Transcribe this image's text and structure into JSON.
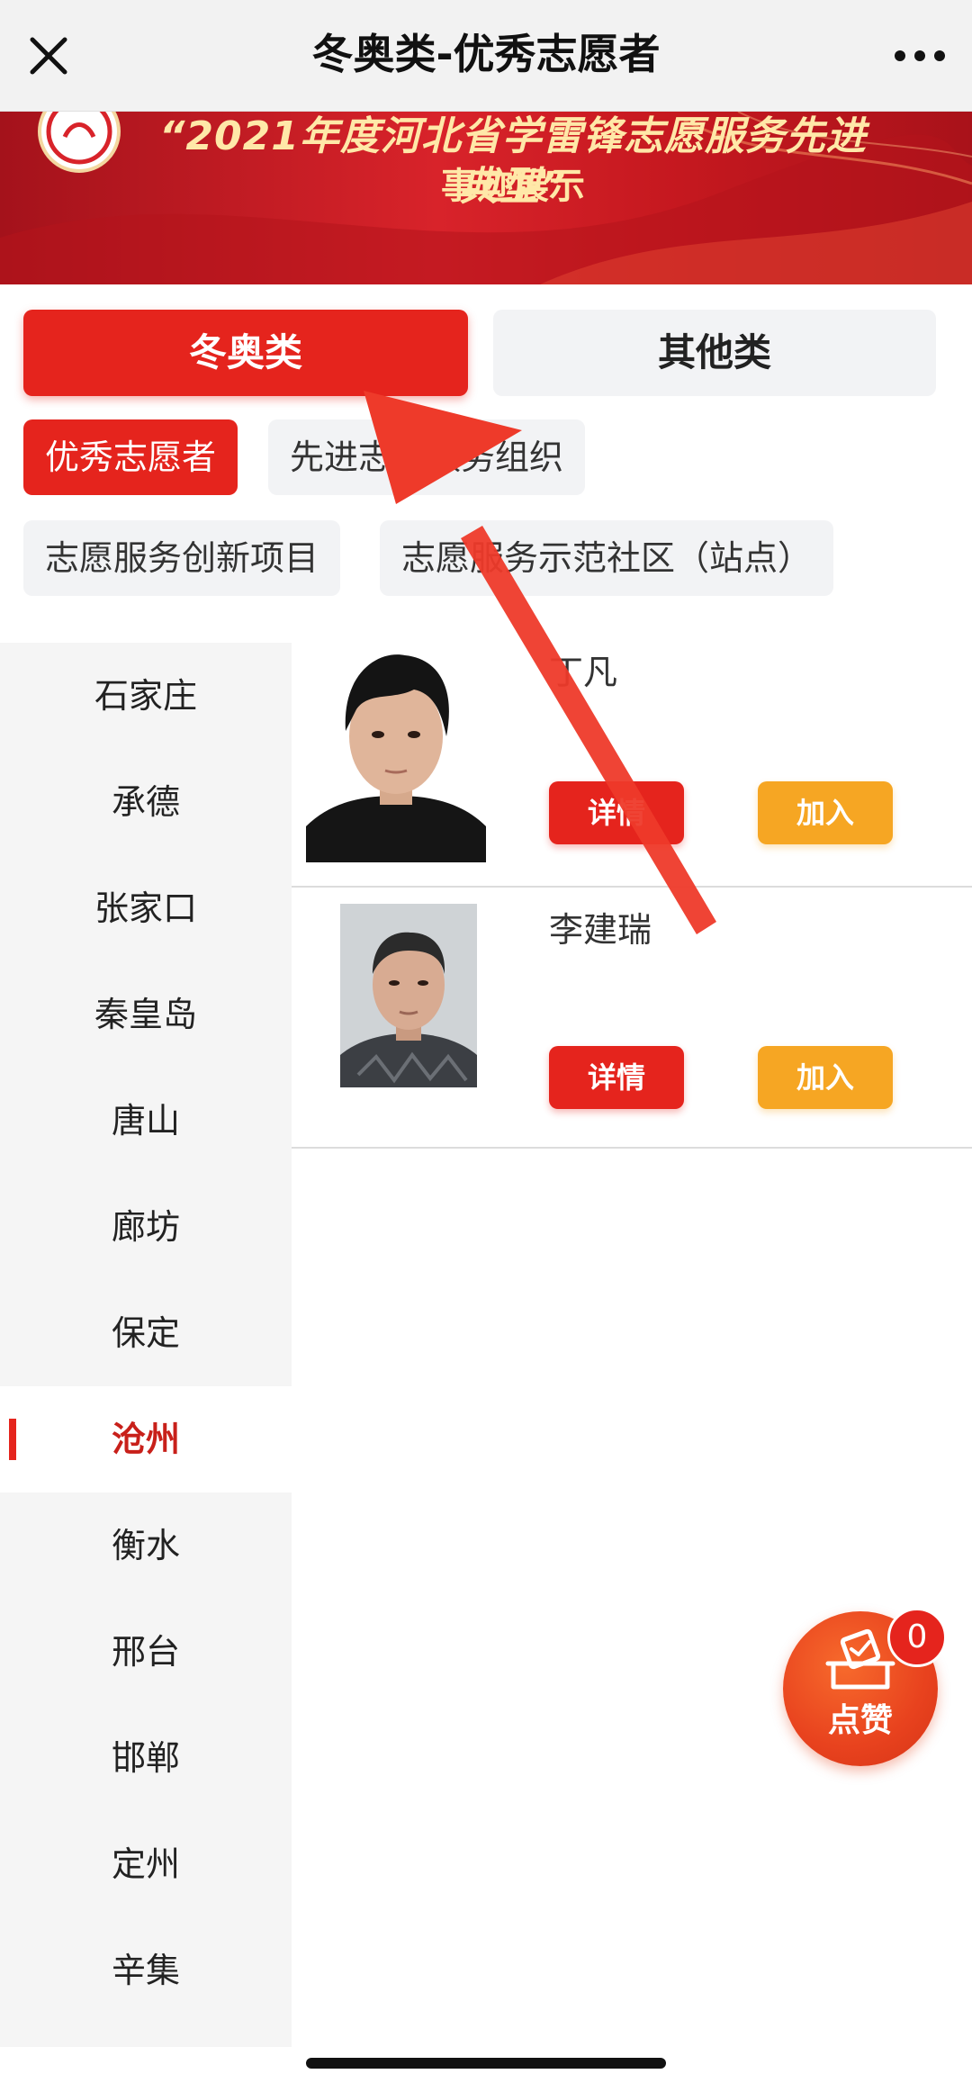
{
  "navbar": {
    "title": "冬奥类-优秀志愿者",
    "close_icon": "close-icon",
    "more_icon": "more-dots-icon"
  },
  "banner": {
    "line1": "“2021年度河北省学雷锋志愿服务先进典型”",
    "line2": "事迹展示"
  },
  "category_tabs": [
    {
      "label": "冬奥类",
      "active": true
    },
    {
      "label": "其他类",
      "active": false
    }
  ],
  "sub_chips": [
    {
      "label": "优秀志愿者",
      "active": true
    },
    {
      "label": "先进志愿服务组织",
      "active": false
    },
    {
      "label": "志愿服务创新项目",
      "active": false
    },
    {
      "label": "志愿服务示范社区（站点）",
      "active": false
    }
  ],
  "cities": [
    {
      "label": "石家庄"
    },
    {
      "label": "承德"
    },
    {
      "label": "张家口"
    },
    {
      "label": "秦皇岛"
    },
    {
      "label": "唐山"
    },
    {
      "label": "廊坊"
    },
    {
      "label": "保定"
    },
    {
      "label": "沧州",
      "active": true
    },
    {
      "label": "衡水"
    },
    {
      "label": "邢台"
    },
    {
      "label": "邯郸"
    },
    {
      "label": "定州"
    },
    {
      "label": "辛集"
    }
  ],
  "volunteers": [
    {
      "name": "丁凡",
      "detail_label": "详情",
      "join_label": "加入"
    },
    {
      "name": "李建瑞",
      "detail_label": "详情",
      "join_label": "加入"
    }
  ],
  "like": {
    "label": "点赞",
    "count": "0",
    "icon": "ballot-box-icon"
  },
  "colors": {
    "accent": "#e5241d",
    "join": "#f6a623",
    "arrow": "#ee3a2a"
  }
}
